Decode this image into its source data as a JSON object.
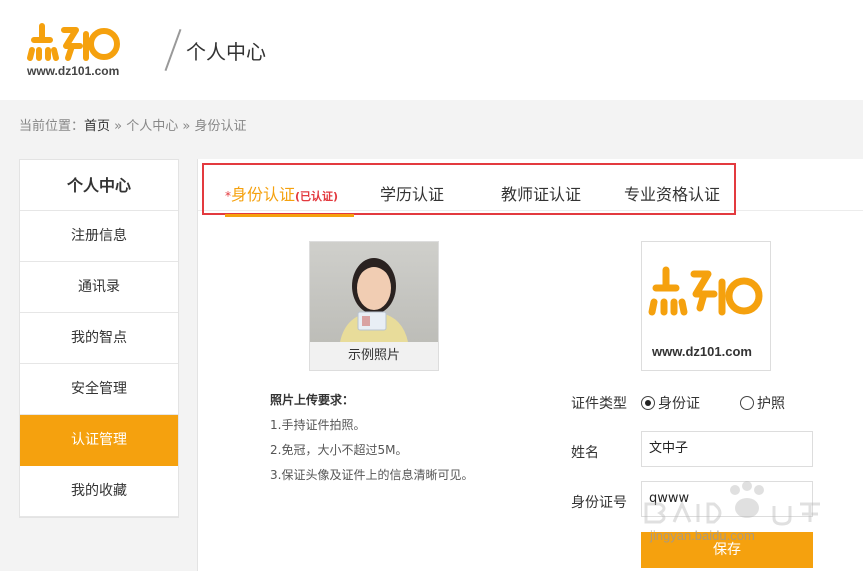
{
  "header": {
    "logo_url": "www.dz101.com",
    "title": "个人中心"
  },
  "breadcrumb": {
    "prefix": "当前位置：",
    "home": "首页",
    "sep1": " » ",
    "item1": "个人中心",
    "sep2": " » ",
    "item2": "身份认证"
  },
  "sidebar": {
    "title": "个人中心",
    "items": [
      {
        "label": "注册信息"
      },
      {
        "label": "通讯录"
      },
      {
        "label": "我的智点"
      },
      {
        "label": "安全管理"
      },
      {
        "label": "认证管理",
        "active": true
      },
      {
        "label": "我的收藏"
      }
    ]
  },
  "tabs": [
    {
      "star": "*",
      "label": "身份认证",
      "status": "(已认证)",
      "active": true
    },
    {
      "label": "学历认证"
    },
    {
      "label": "教师证认证"
    },
    {
      "label": "专业资格认证"
    }
  ],
  "sample_photo": {
    "caption": "示例照片"
  },
  "preview_photo": {
    "url_text": "www.dz101.com"
  },
  "requirements": {
    "title": "照片上传要求：",
    "items": [
      "1.手持证件拍照。",
      "2.免冠，大小不超过5M。",
      "3.保证头像及证件上的信息清晰可见。"
    ]
  },
  "form": {
    "id_type_label": "证件类型",
    "id_type_options": [
      {
        "label": "身份证",
        "checked": true
      },
      {
        "label": "护照",
        "checked": false
      }
    ],
    "name_label": "姓名",
    "name_value": "文中子",
    "id_number_label": "身份证号",
    "id_number_value": "qwww",
    "save_label": "保存"
  },
  "watermark": {
    "text": "jingyan.baidu.com"
  },
  "colors": {
    "accent": "#f5a10e",
    "highlight_border": "#e33a3f"
  }
}
